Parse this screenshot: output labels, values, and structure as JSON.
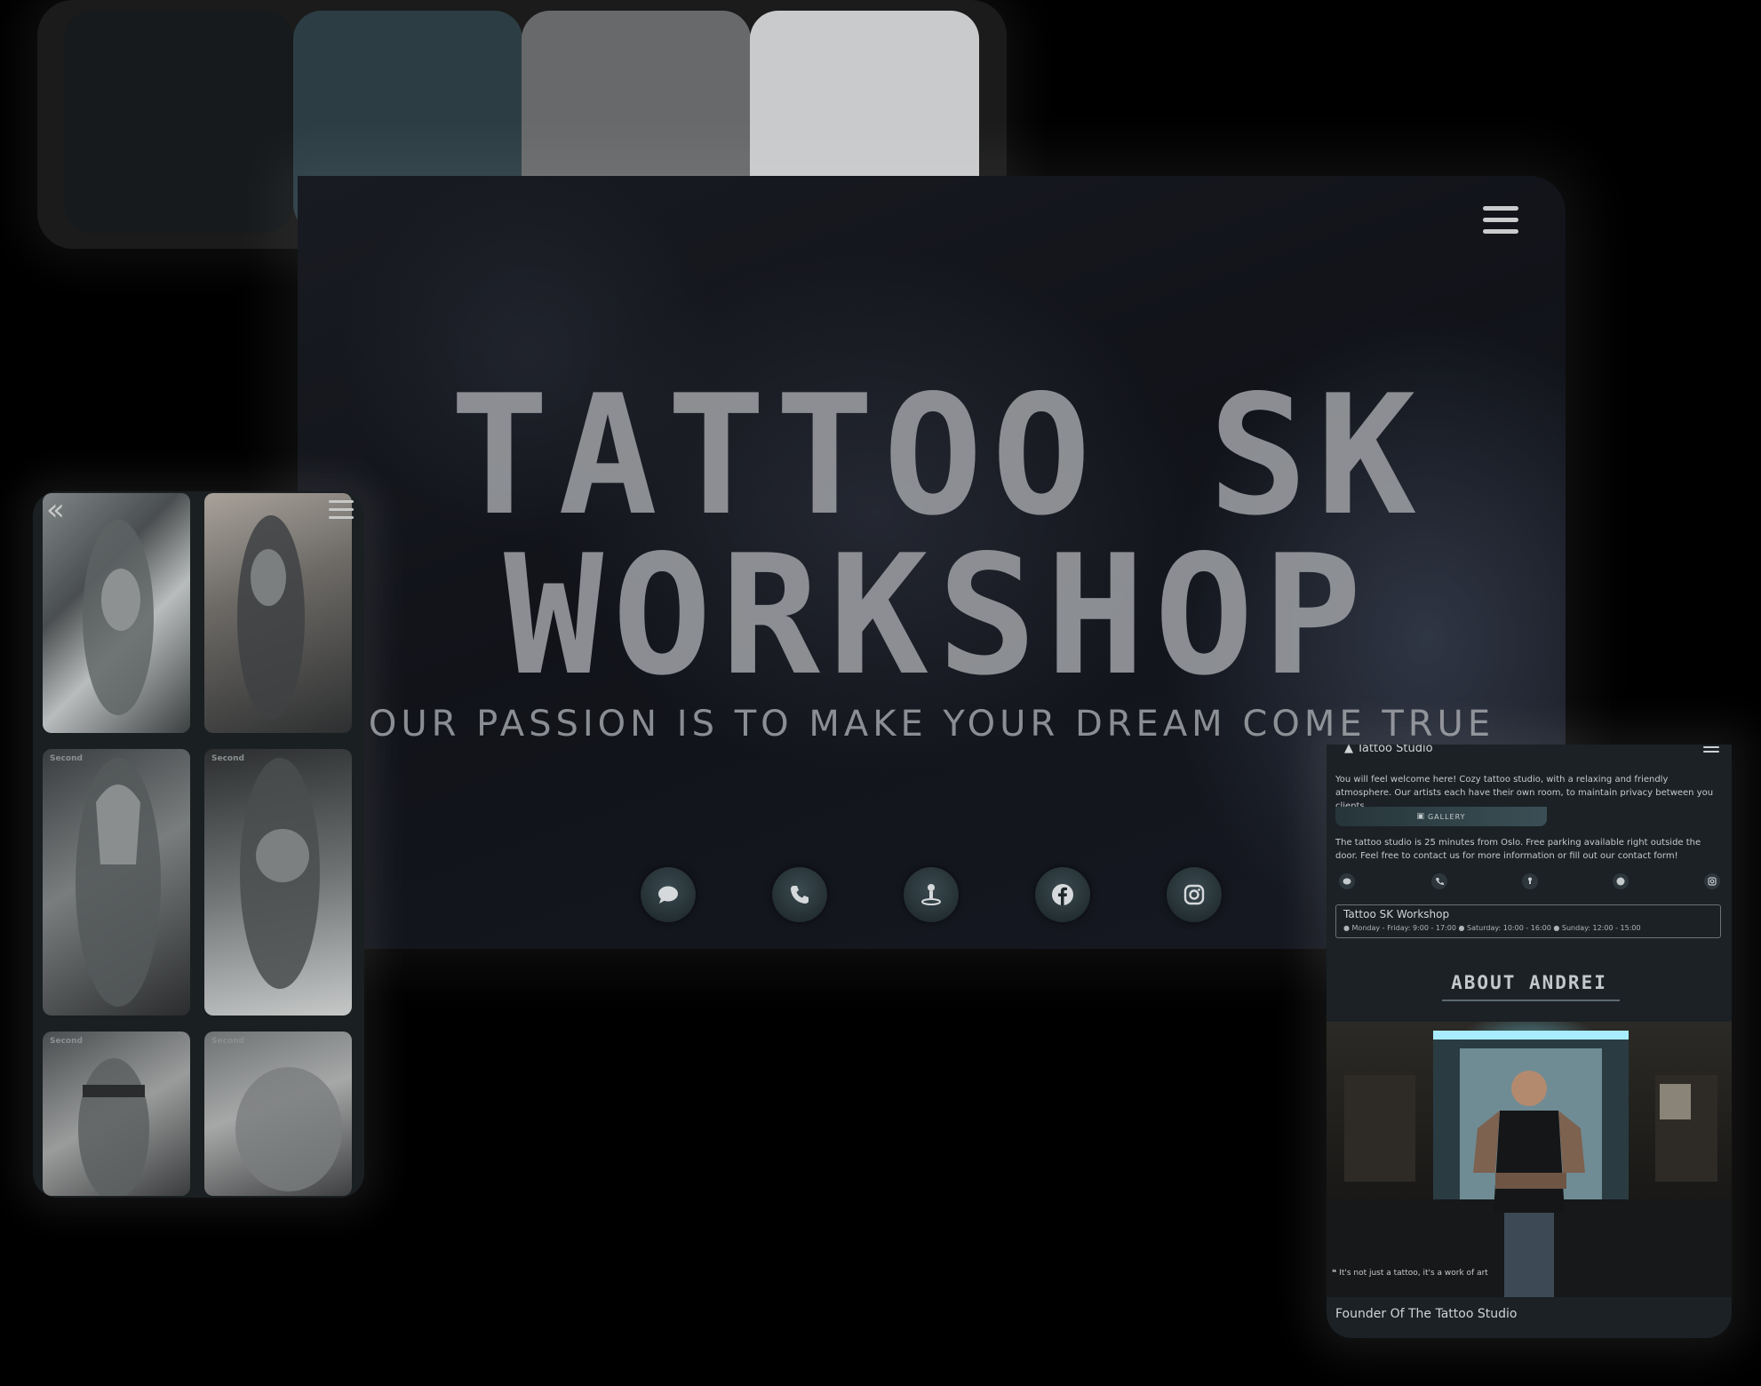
{
  "palette": {
    "colors": [
      "#161a1d",
      "#2c3e44",
      "#68696b",
      "#c9cacc"
    ]
  },
  "desktop": {
    "title_line1": "TATTOO SK",
    "title_line2": "WORKSHOP",
    "subtitle": "OUR PASSION IS TO MAKE YOUR DREAM COME TRUE",
    "menu_icon": "hamburger-icon",
    "social_icons": [
      "chat-icon",
      "phone-icon",
      "location-pin-icon",
      "facebook-icon",
      "instagram-icon"
    ]
  },
  "gallery": {
    "tile_tag": "Second",
    "back_icon": "double-chevron-left-icon",
    "menu_icon": "hamburger-icon"
  },
  "about_phone": {
    "header": "Tattoo Studio",
    "intro": "You will feel welcome here! Cozy tattoo studio, with a relaxing and friendly atmosphere. Our artists each have their own room, to maintain privacy between you clients.",
    "gallery_button": "GALLERY",
    "location_text": "The tattoo studio is 25 minutes from Oslo. Free parking available right outside the door. Feel free to contact us for more information or fill out our contact form!",
    "hours_title": "Tattoo SK Workshop",
    "hours_text": "● Monday - Friday: 9:00 - 17:00 ● Saturday: 10:00 - 16:00 ● Sunday: 12:00 - 15:00",
    "about_title": "ABOUT ANDREI",
    "quote": "It's not just a tattoo, it's a work of art",
    "founder": "Founder Of The Tattoo Studio"
  }
}
